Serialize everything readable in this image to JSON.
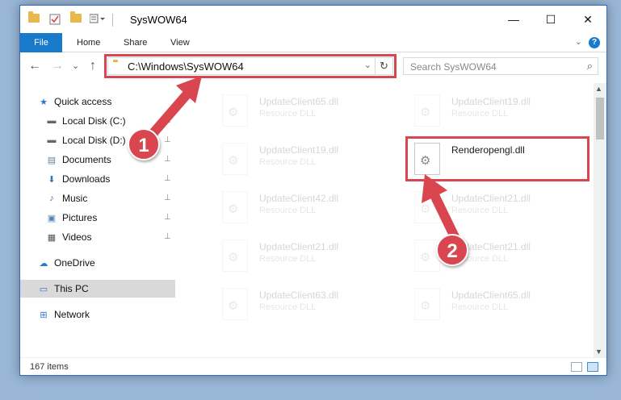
{
  "window": {
    "title": "SysWOW64",
    "controls": {
      "minimize": "—",
      "maximize": "☐",
      "close": "✕"
    }
  },
  "ribbon": {
    "tabs": [
      "File",
      "Home",
      "Share",
      "View"
    ],
    "expand_glyph": "⌄",
    "help_glyph": "?"
  },
  "nav": {
    "back": "←",
    "forward": "→",
    "recent": "⌄",
    "up": "↑",
    "address": "C:\\Windows\\SysWOW64",
    "address_dropdown": "⌄",
    "refresh": "↻",
    "search_placeholder": "Search SysWOW64",
    "search_glyph": "⌕"
  },
  "sidebar": {
    "items": [
      {
        "label": "Quick access",
        "icon": "star-icon",
        "glyph": "★",
        "color": "#2b78c6",
        "pinned": false
      },
      {
        "label": "Local Disk (C:)",
        "icon": "drive-icon",
        "glyph": "▬",
        "color": "#666666",
        "pinned": true
      },
      {
        "label": "Local Disk (D:)",
        "icon": "drive-icon",
        "glyph": "▬",
        "color": "#666666",
        "pinned": true
      },
      {
        "label": "Documents",
        "icon": "documents-icon",
        "glyph": "▤",
        "color": "#6a7f99",
        "pinned": true
      },
      {
        "label": "Downloads",
        "icon": "downloads-icon",
        "glyph": "⬇",
        "color": "#2b78c6",
        "pinned": true
      },
      {
        "label": "Music",
        "icon": "music-icon",
        "glyph": "♪",
        "color": "#2b78c6",
        "pinned": true
      },
      {
        "label": "Pictures",
        "icon": "pictures-icon",
        "glyph": "▣",
        "color": "#5a86b6",
        "pinned": true
      },
      {
        "label": "Videos",
        "icon": "videos-icon",
        "glyph": "▦",
        "color": "#555555",
        "pinned": true
      },
      {
        "label": "OneDrive",
        "icon": "onedrive-icon",
        "glyph": "☁",
        "color": "#2b78c6",
        "pinned": false
      },
      {
        "label": "This PC",
        "icon": "this-pc-icon",
        "glyph": "▭",
        "color": "#2b78c6",
        "pinned": false
      },
      {
        "label": "Network",
        "icon": "network-icon",
        "glyph": "⊞",
        "color": "#2b78c6",
        "pinned": false
      }
    ],
    "pin_glyph": "📌"
  },
  "files": [
    {
      "name": "UpdateClient65.dll",
      "type": "Resource DLL",
      "ghost": true
    },
    {
      "name": "UpdateClient19.dll",
      "type": "Resource DLL",
      "ghost": true
    },
    {
      "name": "UpdateClient19.dll",
      "type": "Resource DLL",
      "ghost": true
    },
    {
      "name": "Renderopengl.dll",
      "type": "",
      "ghost": false
    },
    {
      "name": "UpdateClient42.dll",
      "type": "Resource DLL",
      "ghost": true
    },
    {
      "name": "UpdateClient21.dll",
      "type": "Resource DLL",
      "ghost": true
    },
    {
      "name": "UpdateClient21.dll",
      "type": "Resource DLL",
      "ghost": true
    },
    {
      "name": "UpdateClient21.dll",
      "type": "Resource DLL",
      "ghost": true
    },
    {
      "name": "UpdateClient63.dll",
      "type": "Resource DLL",
      "ghost": true
    },
    {
      "name": "UpdateClient65.dll",
      "type": "Resource DLL",
      "ghost": true
    }
  ],
  "status": {
    "items": "167 items"
  },
  "annotations": {
    "step1": "1",
    "step2": "2",
    "color": "#d9464f"
  }
}
